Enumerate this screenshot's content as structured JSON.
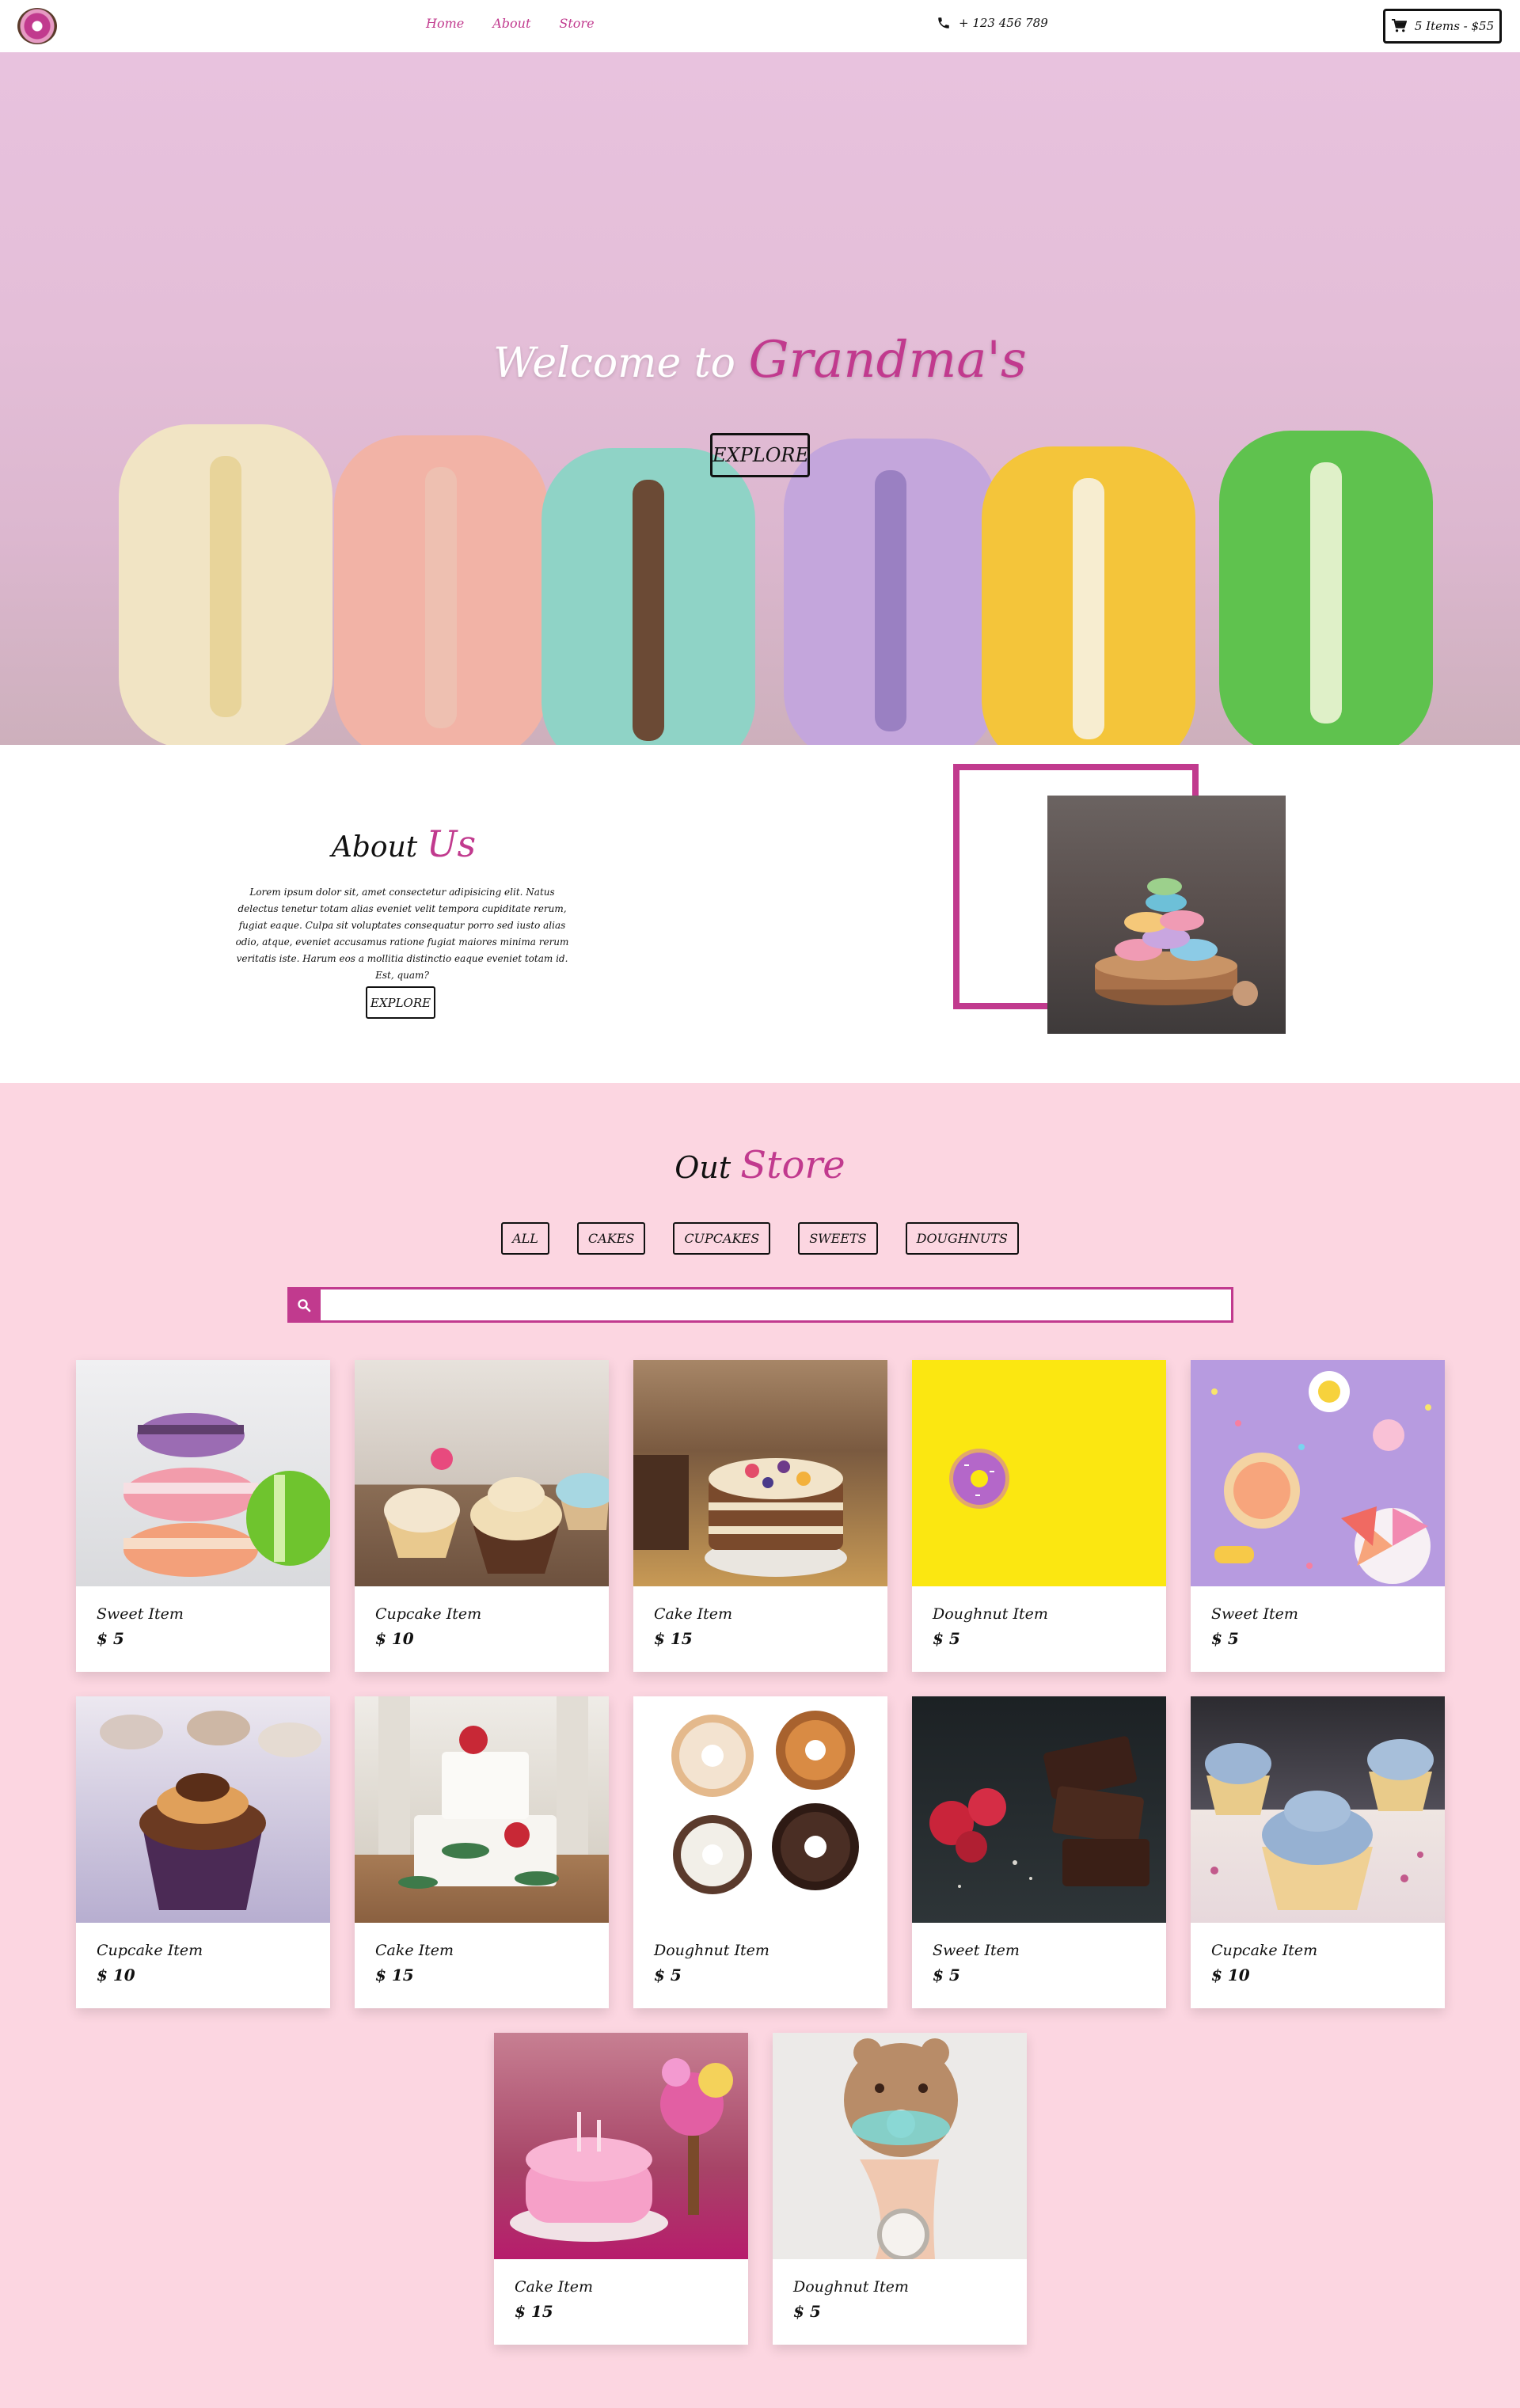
{
  "nav": {
    "links": [
      "Home",
      "About",
      "Store"
    ],
    "phone": "+ 123 456 789",
    "cart": "5 Items - $55"
  },
  "hero": {
    "title_prefix": "Welcome to",
    "title_accent": "Grandma's",
    "button": "EXPLORE"
  },
  "about": {
    "title_prefix": "About",
    "title_accent": "Us",
    "text": "Lorem ipsum dolor sit, amet consectetur adipisicing elit. Natus delectus tenetur totam alias eveniet velit tempora cupiditate rerum, fugiat eaque. Culpa sit voluptates consequatur porro sed iusto alias odio, atque, eveniet accusamus ratione fugiat maiores minima rerum veritatis iste. Harum eos a mollitia distinctio eaque eveniet totam id. Est, quam?",
    "button": "EXPLORE"
  },
  "store": {
    "title_prefix": "Out",
    "title_accent": "Store",
    "filters": [
      "ALL",
      "CAKES",
      "CUPCAKES",
      "SWEETS",
      "DOUGHNUTS"
    ],
    "search_value": "",
    "items": [
      {
        "name": "Sweet Item",
        "price": "$ 5",
        "icon": "macaron-stack-image"
      },
      {
        "name": "Cupcake Item",
        "price": "$ 10",
        "icon": "cupcakes-image"
      },
      {
        "name": "Cake Item",
        "price": "$ 15",
        "icon": "layer-cake-image"
      },
      {
        "name": "Doughnut Item",
        "price": "$ 5",
        "icon": "doughnut-yellow-image"
      },
      {
        "name": "Sweet Item",
        "price": "$ 5",
        "icon": "candy-sprinkles-image"
      },
      {
        "name": "Cupcake Item",
        "price": "$ 10",
        "icon": "chocolate-cupcake-image"
      },
      {
        "name": "Cake Item",
        "price": "$ 15",
        "icon": "white-cake-image"
      },
      {
        "name": "Doughnut Item",
        "price": "$ 5",
        "icon": "four-doughnuts-image"
      },
      {
        "name": "Sweet Item",
        "price": "$ 5",
        "icon": "chocolate-raspberry-image"
      },
      {
        "name": "Cupcake Item",
        "price": "$ 10",
        "icon": "blue-cupcakes-image"
      },
      {
        "name": "Cake Item",
        "price": "$ 15",
        "icon": "pink-cake-image"
      },
      {
        "name": "Doughnut Item",
        "price": "$ 5",
        "icon": "bear-doughnut-image"
      }
    ]
  },
  "colors": {
    "accent": "#c13a8e",
    "store_bg": "#fcd6e1"
  }
}
